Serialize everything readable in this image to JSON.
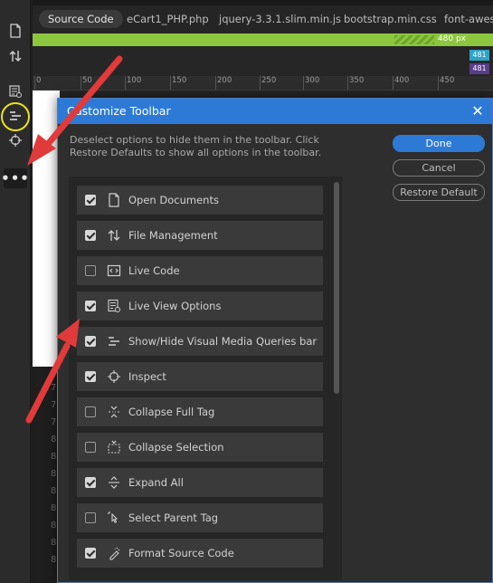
{
  "file_tabs": {
    "active": "Source Code",
    "others": [
      "eCart1_PHP.php",
      "jquery-3.3.1.slim.min.js",
      "bootstrap.min.css",
      "font-aweso"
    ]
  },
  "media_query": {
    "label": "480 px",
    "breakpoint_1": "481",
    "breakpoint_2": "481"
  },
  "ruler": [
    "0",
    "50",
    "100",
    "150",
    "200",
    "250",
    "300",
    "350",
    "400",
    "450"
  ],
  "line_numbers": [
    "7",
    "7",
    "7",
    "8",
    "8",
    "8",
    "8",
    "8",
    "8",
    "8",
    "8"
  ],
  "dialog": {
    "title": "Customize Toolbar",
    "instructions": "Deselect options to hide them in the toolbar. Click Restore Defaults to show all options in the toolbar.",
    "done_label": "Done",
    "cancel_label": "Cancel",
    "restore_label": "Restore Default"
  },
  "options": [
    {
      "label": "Open Documents",
      "checked": true,
      "icon": "document-icon"
    },
    {
      "label": "File Management",
      "checked": true,
      "icon": "file-transfer-icon"
    },
    {
      "label": "Live Code",
      "checked": false,
      "icon": "live-code-icon"
    },
    {
      "label": "Live View Options",
      "checked": true,
      "icon": "live-view-options-icon"
    },
    {
      "label": "Show/Hide Visual Media Queries bar",
      "checked": true,
      "icon": "media-queries-icon"
    },
    {
      "label": "Inspect",
      "checked": true,
      "icon": "crosshair-icon"
    },
    {
      "label": "Collapse Full Tag",
      "checked": false,
      "icon": "collapse-full-tag-icon"
    },
    {
      "label": "Collapse Selection",
      "checked": false,
      "icon": "collapse-selection-icon"
    },
    {
      "label": "Expand All",
      "checked": true,
      "icon": "expand-all-icon"
    },
    {
      "label": "Select Parent Tag",
      "checked": false,
      "icon": "select-parent-tag-icon"
    },
    {
      "label": "Format Source Code",
      "checked": true,
      "icon": "format-code-icon"
    }
  ],
  "colors": {
    "accent": "#2d7ad6",
    "mq_bar": "#8cc63f",
    "annotation": "#e03a3a",
    "highlight_ring": "#e8e21a"
  }
}
